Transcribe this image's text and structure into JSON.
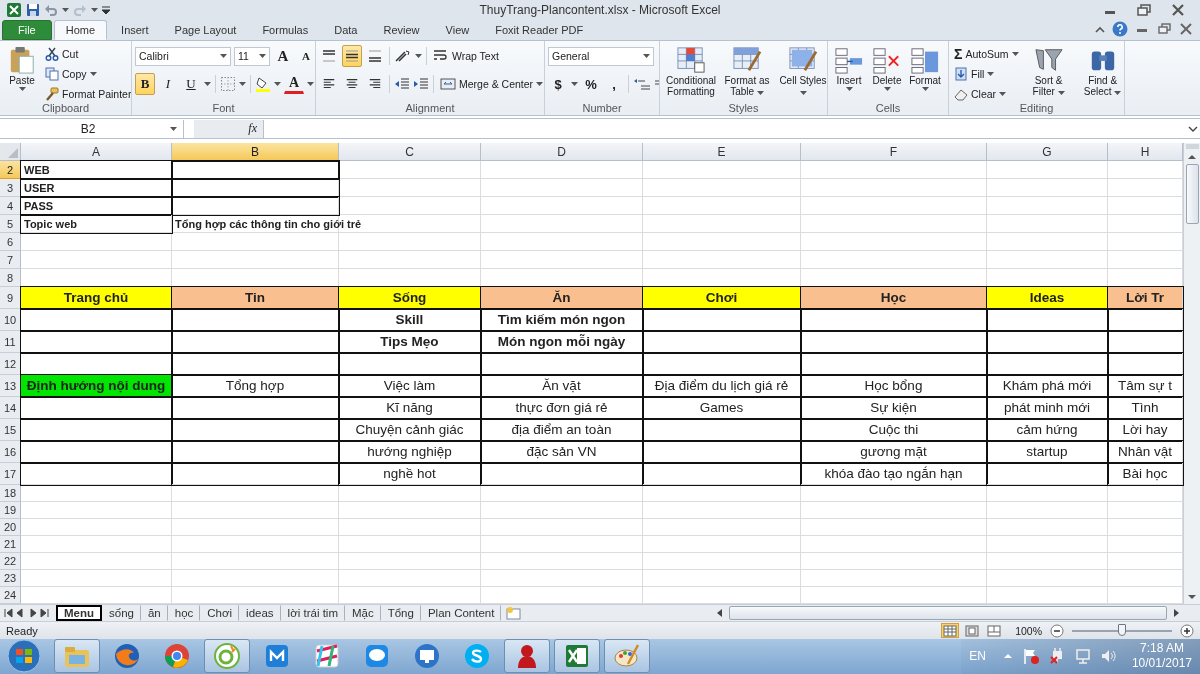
{
  "title_bar": {
    "title": "ThuyTrang-Plancontent.xlsx - Microsoft Excel"
  },
  "ribbon": {
    "tabs": [
      {
        "label": "File",
        "kind": "file",
        "selected": false
      },
      {
        "label": "Home",
        "kind": "tab",
        "selected": true
      },
      {
        "label": "Insert",
        "kind": "tab",
        "selected": false
      },
      {
        "label": "Page Layout",
        "kind": "tab",
        "selected": false
      },
      {
        "label": "Formulas",
        "kind": "tab",
        "selected": false
      },
      {
        "label": "Data",
        "kind": "tab",
        "selected": false
      },
      {
        "label": "Review",
        "kind": "tab",
        "selected": false
      },
      {
        "label": "View",
        "kind": "tab",
        "selected": false
      },
      {
        "label": "Foxit Reader PDF",
        "kind": "tab",
        "selected": false
      }
    ],
    "clipboard": {
      "label": "Clipboard",
      "paste": "Paste",
      "cut": "Cut",
      "copy": "Copy",
      "format_painter": "Format Painter"
    },
    "font": {
      "label": "Font",
      "font_name": "Calibri",
      "font_size": "11",
      "grow": "A",
      "shrink": "A",
      "bold": {
        "label": "B",
        "on": true
      },
      "italic": {
        "label": "I",
        "on": false
      },
      "underline": {
        "label": "U",
        "on": false
      },
      "font_color": "A"
    },
    "alignment": {
      "label": "Alignment",
      "vertical": [
        {
          "kind": "top",
          "selected": false
        },
        {
          "kind": "middle",
          "selected": true
        },
        {
          "kind": "bottom",
          "selected": false
        }
      ],
      "horizontal": [
        {
          "kind": "left",
          "selected": false
        },
        {
          "kind": "center",
          "selected": false
        },
        {
          "kind": "right",
          "selected": false
        }
      ],
      "wrap_text": "Wrap Text",
      "merge": "Merge & Center"
    },
    "number": {
      "label": "Number",
      "format": "General",
      "currency": "$",
      "percent": "%",
      "comma": ","
    },
    "styles": {
      "label": "Styles",
      "buttons": [
        {
          "label": "Conditional Formatting",
          "kind": "conditional"
        },
        {
          "label": "Format as Table",
          "kind": "table"
        },
        {
          "label": "Cell Styles",
          "kind": "cell-styles"
        }
      ]
    },
    "cells": {
      "label": "Cells",
      "buttons": [
        {
          "label": "Insert",
          "kind": "insert"
        },
        {
          "label": "Delete",
          "kind": "delete"
        },
        {
          "label": "Format",
          "kind": "format"
        }
      ]
    },
    "editing": {
      "label": "Editing",
      "sigma": "Σ",
      "autosum": "AutoSum",
      "fill": "Fill",
      "clear": "Clear",
      "sort": "Sort & Filter",
      "find": "Find & Select"
    }
  },
  "formula_bar": {
    "name_box": "B2",
    "fx": "fx"
  },
  "grid": {
    "columns": [
      {
        "letter": "A",
        "selected": false
      },
      {
        "letter": "B",
        "selected": true
      },
      {
        "letter": "C",
        "selected": false
      },
      {
        "letter": "D",
        "selected": false
      },
      {
        "letter": "E",
        "selected": false
      },
      {
        "letter": "F",
        "selected": false
      },
      {
        "letter": "G",
        "selected": false
      },
      {
        "letter": "H",
        "selected": false
      }
    ],
    "rows": [
      {
        "number": "2",
        "kind": "compact",
        "selected": true,
        "cells": [
          {
            "text": "WEB",
            "bold": true,
            "bordered": true
          },
          {
            "bordered": true,
            "selected": true
          },
          {},
          {},
          {},
          {},
          {},
          {}
        ]
      },
      {
        "number": "3",
        "kind": "compact",
        "selected": false,
        "cells": [
          {
            "text": "USER",
            "bold": true,
            "bordered": true
          },
          {
            "bordered": true
          },
          {},
          {},
          {},
          {},
          {},
          {}
        ]
      },
      {
        "number": "4",
        "kind": "compact",
        "selected": false,
        "cells": [
          {
            "text": "PASS",
            "bold": true,
            "bordered": true
          },
          {
            "bordered": true
          },
          {},
          {},
          {},
          {},
          {},
          {}
        ]
      },
      {
        "number": "5",
        "kind": "compact",
        "selected": false,
        "cells": [
          {
            "text": "Topic web",
            "bold": true,
            "bordered": true
          },
          {
            "text": "Tổng hợp các thông tin cho giới trẻ",
            "bold": true
          },
          {},
          {},
          {},
          {},
          {},
          {}
        ]
      },
      {
        "number": "6",
        "kind": "compact",
        "selected": false
      },
      {
        "number": "7",
        "kind": "compact",
        "selected": false
      },
      {
        "number": "8",
        "kind": "compact",
        "selected": false
      },
      {
        "number": "9",
        "kind": "tall",
        "selected": false,
        "cells": [
          {
            "text": "Trang chủ",
            "bold": true,
            "bordered": true,
            "color": "#ffff00"
          },
          {
            "text": "Tin",
            "bold": true,
            "bordered": true,
            "color": "#fabf8f"
          },
          {
            "text": "Sống",
            "bold": true,
            "bordered": true,
            "color": "#ffff00"
          },
          {
            "text": "Ăn",
            "bold": true,
            "bordered": true,
            "color": "#fabf8f"
          },
          {
            "text": "Chơi",
            "bold": true,
            "bordered": true,
            "color": "#ffff00"
          },
          {
            "text": "Học",
            "bold": true,
            "bordered": true,
            "color": "#fabf8f"
          },
          {
            "text": "Ideas",
            "bold": true,
            "bordered": true,
            "color": "#ffff00"
          },
          {
            "text": "Lời Tr",
            "bold": true,
            "bordered": true,
            "color": "#fabf8f"
          }
        ]
      },
      {
        "number": "10",
        "kind": "tall",
        "selected": false,
        "cells": [
          {
            "bordered": true
          },
          {
            "bordered": true
          },
          {
            "text": "Skill",
            "bold": true,
            "bordered": true
          },
          {
            "text": "Tìm kiếm món ngon",
            "bold": true,
            "bordered": true
          },
          {
            "bordered": true
          },
          {
            "bordered": true
          },
          {
            "bordered": true
          },
          {
            "bordered": true
          }
        ]
      },
      {
        "number": "11",
        "kind": "tall",
        "selected": false,
        "cells": [
          {
            "bordered": true
          },
          {
            "bordered": true
          },
          {
            "text": "Tips Mẹo",
            "bold": true,
            "bordered": true
          },
          {
            "text": "Món ngon mỗi ngày",
            "bold": true,
            "bordered": true
          },
          {
            "bordered": true
          },
          {
            "bordered": true
          },
          {
            "bordered": true
          },
          {
            "bordered": true
          }
        ]
      },
      {
        "number": "12",
        "kind": "tall",
        "selected": false,
        "cells": [
          {
            "bordered": true
          },
          {
            "bordered": true
          },
          {
            "bordered": true
          },
          {
            "bordered": true
          },
          {
            "bordered": true
          },
          {
            "bordered": true
          },
          {
            "bordered": true
          },
          {
            "bordered": true
          }
        ]
      },
      {
        "number": "13",
        "kind": "tall",
        "selected": false,
        "cells": [
          {
            "text": "Định hướng nội dung",
            "bold": true,
            "bordered": true,
            "color": "#00e600"
          },
          {
            "text": "Tổng hợp",
            "bordered": true
          },
          {
            "text": "Việc làm",
            "bordered": true
          },
          {
            "text": "Ăn vặt",
            "bordered": true
          },
          {
            "text": "Địa điểm du lịch giá rẻ",
            "bordered": true
          },
          {
            "text": "Học bổng",
            "bordered": true
          },
          {
            "text": "Khám phá mới",
            "bordered": true
          },
          {
            "text": "Tâm sự t",
            "bordered": true
          }
        ]
      },
      {
        "number": "14",
        "kind": "tall",
        "selected": false,
        "cells": [
          {
            "bordered": true
          },
          {
            "bordered": true
          },
          {
            "text": "Kĩ năng",
            "bordered": true
          },
          {
            "text": "thực đơn giá rẻ",
            "bordered": true
          },
          {
            "text": "Games",
            "bordered": true
          },
          {
            "text": "Sự kiện",
            "bordered": true
          },
          {
            "text": "phát minh mới",
            "bordered": true
          },
          {
            "text": "Tình",
            "bordered": true
          }
        ]
      },
      {
        "number": "15",
        "kind": "tall",
        "selected": false,
        "cells": [
          {
            "bordered": true
          },
          {
            "bordered": true
          },
          {
            "text": "Chuyện cảnh giác",
            "bordered": true
          },
          {
            "text": "địa điểm an toàn",
            "bordered": true
          },
          {
            "bordered": true
          },
          {
            "text": "Cuộc thi",
            "bordered": true
          },
          {
            "text": "cảm hứng",
            "bordered": true
          },
          {
            "text": "Lời hay",
            "bordered": true
          }
        ]
      },
      {
        "number": "16",
        "kind": "tall",
        "selected": false,
        "cells": [
          {
            "bordered": true
          },
          {
            "bordered": true
          },
          {
            "text": "hướng nghiệp",
            "bordered": true
          },
          {
            "text": "đặc sản VN",
            "bordered": true
          },
          {
            "bordered": true
          },
          {
            "text": "gương mặt",
            "bordered": true
          },
          {
            "text": "startup",
            "bordered": true
          },
          {
            "text": "Nhân vật",
            "bordered": true
          }
        ]
      },
      {
        "number": "17",
        "kind": "tall",
        "selected": false,
        "cells": [
          {
            "bordered": true
          },
          {
            "bordered": true
          },
          {
            "text": "nghề hot",
            "bordered": true
          },
          {
            "bordered": true
          },
          {
            "bordered": true
          },
          {
            "text": "khóa đào tạo ngắn hạn",
            "bordered": true
          },
          {
            "bordered": true
          },
          {
            "text": "Bài học",
            "bordered": true
          }
        ]
      },
      {
        "number": "18",
        "kind": "plain",
        "selected": false
      },
      {
        "number": "19",
        "kind": "plain",
        "selected": false
      },
      {
        "number": "20",
        "kind": "plain",
        "selected": false
      },
      {
        "number": "21",
        "kind": "plain",
        "selected": false
      },
      {
        "number": "22",
        "kind": "plain",
        "selected": false
      },
      {
        "number": "23",
        "kind": "plain",
        "selected": false
      },
      {
        "number": "24",
        "kind": "plain",
        "selected": false
      }
    ]
  },
  "sheet_tabs": [
    {
      "label": "Menu",
      "selected": true
    },
    {
      "label": "sống",
      "selected": false
    },
    {
      "label": "ăn",
      "selected": false
    },
    {
      "label": "học",
      "selected": false
    },
    {
      "label": "Chơi",
      "selected": false
    },
    {
      "label": "ideas",
      "selected": false
    },
    {
      "label": "lời trái tim",
      "selected": false
    },
    {
      "label": "Mặc",
      "selected": false
    },
    {
      "label": "Tổng",
      "selected": false
    },
    {
      "label": "Plan Content",
      "selected": false
    }
  ],
  "status_bar": {
    "status": "Ready",
    "views": [
      {
        "kind": "normal",
        "selected": true
      },
      {
        "kind": "page-layout",
        "selected": false
      },
      {
        "kind": "page-break",
        "selected": false
      }
    ],
    "zoom": "100%",
    "zoom_slider": {
      "level": 0.5
    }
  },
  "taskbar": {
    "apps": [
      {
        "kind": "explorer",
        "running": true
      },
      {
        "kind": "firefox",
        "running": false
      },
      {
        "kind": "chrome",
        "running": false
      },
      {
        "kind": "coccoc",
        "running": true
      },
      {
        "kind": "maxthon",
        "running": false
      },
      {
        "kind": "slack",
        "running": false
      },
      {
        "kind": "zalo",
        "running": false
      },
      {
        "kind": "monitor",
        "running": false
      },
      {
        "kind": "skype",
        "running": false
      },
      {
        "kind": "figure",
        "running": true
      },
      {
        "kind": "excel",
        "running": true
      },
      {
        "kind": "paint",
        "running": true
      }
    ],
    "language": "EN",
    "time": "7:18 AM",
    "date": "10/01/2017"
  }
}
